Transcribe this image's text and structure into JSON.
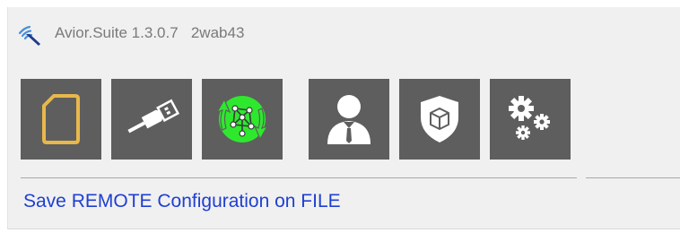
{
  "titlebar": {
    "app_name": "Avior.Suite 1.3.0.7",
    "session_id": "2wab43",
    "app_icon": "signal-pen-icon"
  },
  "toolbar": {
    "buttons": [
      {
        "id": "file",
        "icon": "file-icon",
        "color": "#e8b84a"
      },
      {
        "id": "usb",
        "icon": "usb-icon",
        "color": "#ffffff"
      },
      {
        "id": "remote",
        "icon": "remote-network-icon",
        "color": "#2ee82e"
      },
      {
        "id": "user",
        "icon": "user-icon",
        "color": "#ffffff"
      },
      {
        "id": "security",
        "icon": "shield-icon",
        "color": "#ffffff"
      },
      {
        "id": "settings",
        "icon": "gears-icon",
        "color": "#ffffff"
      }
    ]
  },
  "status": {
    "message": "Save REMOTE Configuration on FILE",
    "color": "#1f3fd1"
  }
}
